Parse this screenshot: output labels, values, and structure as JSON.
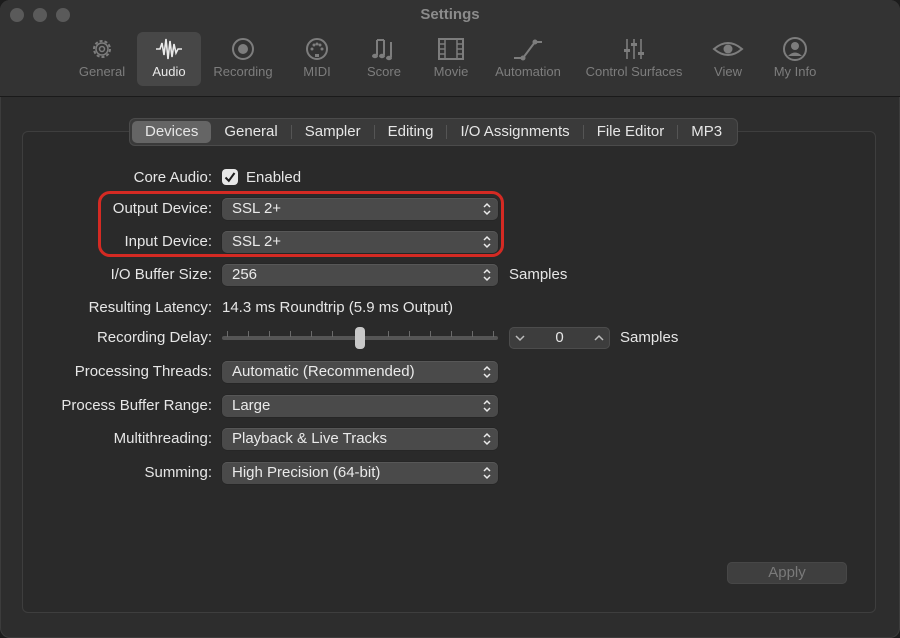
{
  "window": {
    "title": "Settings"
  },
  "toolbar": {
    "items": [
      {
        "label": "General",
        "icon": "gear-icon"
      },
      {
        "label": "Audio",
        "icon": "waveform-icon",
        "active": true
      },
      {
        "label": "Recording",
        "icon": "record-icon"
      },
      {
        "label": "MIDI",
        "icon": "midi-connector-icon"
      },
      {
        "label": "Score",
        "icon": "music-notes-icon"
      },
      {
        "label": "Movie",
        "icon": "film-strip-icon"
      },
      {
        "label": "Automation",
        "icon": "automation-curve-icon"
      },
      {
        "label": "Control Surfaces",
        "icon": "faders-icon"
      },
      {
        "label": "View",
        "icon": "eye-icon"
      },
      {
        "label": "My Info",
        "icon": "person-icon"
      }
    ]
  },
  "tabs": [
    {
      "label": "Devices",
      "active": true
    },
    {
      "label": "General"
    },
    {
      "label": "Sampler"
    },
    {
      "label": "Editing"
    },
    {
      "label": "I/O Assignments"
    },
    {
      "label": "File Editor"
    },
    {
      "label": "MP3"
    }
  ],
  "settings": {
    "core_audio": {
      "label": "Core Audio:",
      "checkbox_label": "Enabled",
      "checked": true
    },
    "output_device": {
      "label": "Output Device:",
      "value": "SSL 2+"
    },
    "input_device": {
      "label": "Input Device:",
      "value": "SSL 2+"
    },
    "io_buffer": {
      "label": "I/O Buffer Size:",
      "value": "256",
      "unit": "Samples"
    },
    "latency": {
      "label": "Resulting Latency:",
      "value": "14.3 ms Roundtrip (5.9 ms Output)"
    },
    "recording_delay": {
      "label": "Recording Delay:",
      "value": "0",
      "unit": "Samples",
      "slider_fraction": 0.5
    },
    "processing_threads": {
      "label": "Processing Threads:",
      "value": "Automatic (Recommended)"
    },
    "buffer_range": {
      "label": "Process Buffer Range:",
      "value": "Large"
    },
    "multithreading": {
      "label": "Multithreading:",
      "value": "Playback & Live Tracks"
    },
    "summing": {
      "label": "Summing:",
      "value": "High Precision (64-bit)"
    }
  },
  "apply_label": "Apply",
  "colors": {
    "highlight": "#d42a23",
    "active_tab": "#656565"
  }
}
